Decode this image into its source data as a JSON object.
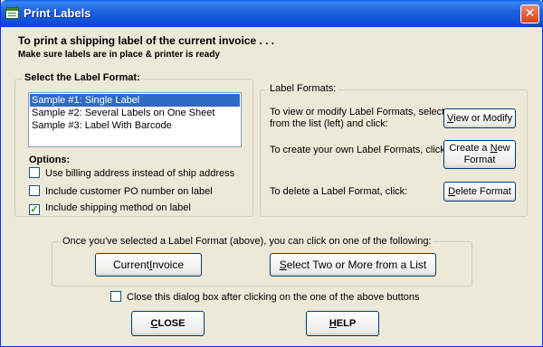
{
  "window": {
    "title": "Print Labels",
    "close_glyph": "✕"
  },
  "header": {
    "line1": "To print a shipping label of the current invoice . . .",
    "line2": "Make sure labels are in place & printer is ready"
  },
  "select_format": {
    "legend": "Select the Label Format:",
    "items": [
      {
        "label": "Sample #1: Single Label",
        "selected": true
      },
      {
        "label": "Sample #2: Several Labels on One Sheet",
        "selected": false
      },
      {
        "label": "Sample #3: Label With Barcode",
        "selected": false
      }
    ]
  },
  "options": {
    "label": "Options:",
    "checks": [
      {
        "label": "Use billing address instead of ship address",
        "checked": false
      },
      {
        "label": "Include customer PO number on label",
        "checked": false
      },
      {
        "label": "Include shipping method on label",
        "checked": true
      }
    ]
  },
  "label_formats": {
    "legend": "Label Formats:",
    "view_text_1": "To view or modify Label Formats, select",
    "view_text_2": "from the list (left) and click:",
    "view_btn": {
      "pre": "",
      "accel": "V",
      "post": "iew or Modify"
    },
    "create_text": "To create your own Label Formats, click:",
    "create_btn": {
      "line1_pre": "Create a ",
      "accel": "N",
      "line1_post": "ew",
      "line2": "Format"
    },
    "delete_text": "To delete a Label Format, click:",
    "delete_btn": {
      "pre": "",
      "accel": "D",
      "post": "elete Format"
    }
  },
  "actions": {
    "legend": "Once you've selected a Label Format (above), you can click on one of the following:",
    "current_invoice": {
      "pre": "Current ",
      "accel": "I",
      "post": "nvoice"
    },
    "select_two": {
      "pre": "",
      "accel": "S",
      "post": "elect Two or More from a List"
    }
  },
  "close_after": {
    "label": "Close this dialog box after clicking on the one of the above buttons",
    "checked": false
  },
  "footer": {
    "close_btn": {
      "pre": "",
      "accel": "C",
      "post": "LOSE"
    },
    "help_btn": {
      "pre": "",
      "accel": "H",
      "post": "ELP"
    }
  },
  "colors": {
    "titlebar": "#0B4FD8",
    "selection": "#316AC5",
    "check": "#21A121",
    "dialog_bg": "#ECE9D8"
  }
}
